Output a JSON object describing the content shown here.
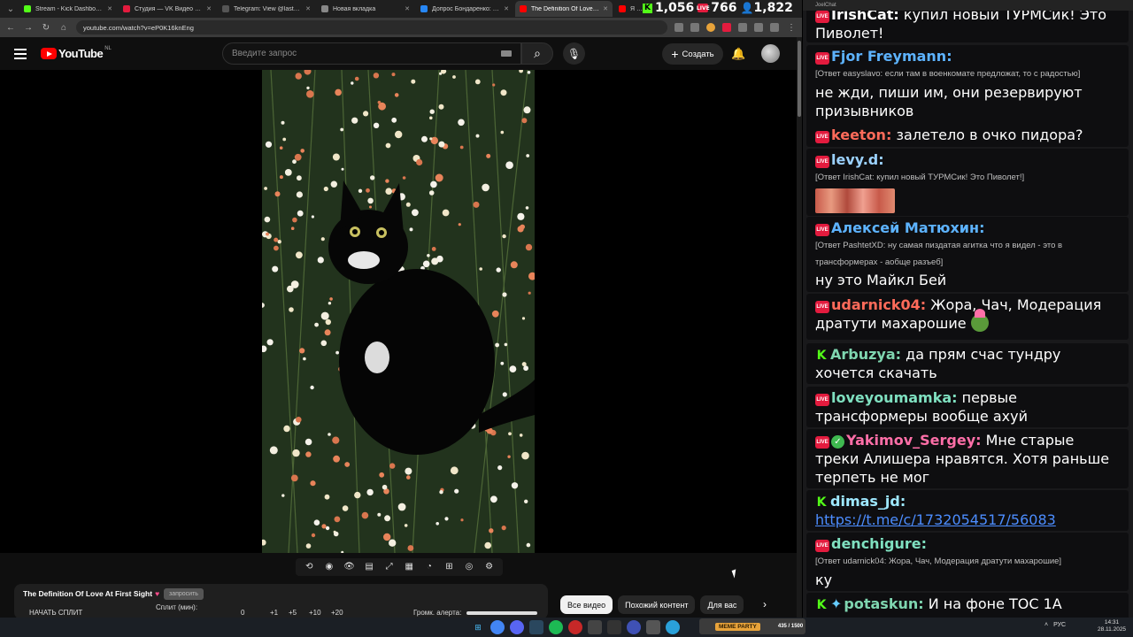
{
  "browser": {
    "tabs": [
      {
        "label": "Stream - Kick Dashboard",
        "color": "#53fc18"
      },
      {
        "label": "Студия — VK Видео Live",
        "color": "#e31b3e"
      },
      {
        "label": "Telegram: View @lastoppo",
        "color": "#555555"
      },
      {
        "label": "Новая вкладка",
        "color": "#888888"
      },
      {
        "label": "Допрос Бондаренко: нарос",
        "color": "#2787f5"
      },
      {
        "label": "The Definition Of Love At Fi",
        "color": "#ff0000"
      },
      {
        "label": "Я посети",
        "color": "#ff0000"
      }
    ],
    "url": "youtube.com/watch?v=eP0K16knEng"
  },
  "stats": {
    "kick_viewers": "1,056",
    "vk_viewers": "766",
    "total_viewers": "1,822",
    "vk_badge": "LIVE"
  },
  "youtube": {
    "logo": "YouTube",
    "country": "NL",
    "search_placeholder": "Введите запрос",
    "create_label": "Создать",
    "video_title": "The Definition Of Love At First Sight",
    "title_emoji": "♥",
    "badge": "запросить",
    "split_button": "НАЧАТЬ СПЛИТ",
    "split_label": "Сплит (мин):",
    "split_values": [
      "0",
      "+1",
      "+5",
      "+10",
      "+20"
    ],
    "alert_volume": "Громк. алерта:",
    "chips": [
      "Все видео",
      "Похожий контент",
      "Для вас"
    ]
  },
  "chat": {
    "window_title": "JoelChat",
    "messages": [
      {
        "platform": "vk",
        "nick": "IrishCat:",
        "color": "#ffffff",
        "text": "купил новый ТУРМСик! Это Пиволет!"
      },
      {
        "platform": "vk",
        "nick": "Fjor Freymann:",
        "color": "#5db3ff",
        "reply": "[Ответ easyslavo: если там в военкомате предложат, то с радостью]",
        "text": "не жди, пиши им, они резервируют призывников"
      },
      {
        "platform": "vk",
        "nick": "keeton:",
        "color": "#ff6b5a",
        "text": "залетело в очко пидора?"
      },
      {
        "platform": "vk",
        "nick": "levy.d:",
        "color": "#9bd1ff",
        "reply": "[Ответ IrishCat: купил новый ТУРМСик! Это Пиволет!]",
        "text": ""
      },
      {
        "platform": "vk",
        "nick": "Алексей Матюхин:",
        "color": "#5db3ff",
        "reply": "[Ответ PashtetXD: ну самая пиздатая агитка что я видел - это в трансформерах - аобще разъеб]",
        "text": "ну это Майкл Бей"
      },
      {
        "platform": "vk",
        "nick": "udarnick04:",
        "color": "#ff6b5a",
        "text": "Жора, Чач, Модерация дратути махарошие"
      },
      {
        "platform": "kick",
        "nick": "Arbuzya:",
        "color": "#7fd6b0",
        "text": "да прям счас тундру хочется скачать"
      },
      {
        "platform": "vk",
        "nick": "loveyoumamka:",
        "color": "#7fe0c0",
        "text": "первые трансформеры вообще ахуй"
      },
      {
        "platform": "vk",
        "nick": "Yakimov_Sergey:",
        "color": "#ff6fa8",
        "text": "Мне старые треки Алишера нравятся. Хотя раньше терпеть не мог"
      },
      {
        "platform": "kick",
        "nick": "dimas_jd:",
        "color": "#9ee8ff",
        "link": "https://t.me/c/1732054517/56083"
      },
      {
        "platform": "vk",
        "nick": "denchigure:",
        "color": "#7fe0c0",
        "reply": "[Ответ udarnick04: Жора, Чач, Модерация дратути махарошие]",
        "text": "ку"
      },
      {
        "platform": "kick",
        "nick": "potaskun:",
        "color": "#7fd6b0",
        "text": "И на фоне ТОС 1А"
      }
    ]
  },
  "taskbar": {
    "widget_label": "MEME PARTY",
    "widget_count": "435 / 1500",
    "lang": "РУС",
    "time": "14:31",
    "date": "28.11.2025"
  }
}
